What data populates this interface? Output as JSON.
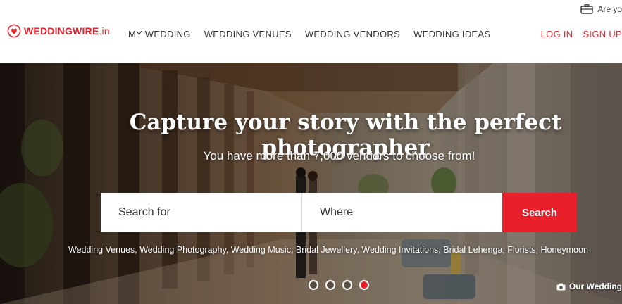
{
  "header": {
    "topbar_text": "Are yo",
    "logo": {
      "name": "WEDDINGWIRE",
      "domain": ".in",
      "color": "#e0242e"
    },
    "nav": [
      "MY WEDDING",
      "WEDDING VENUES",
      "WEDDING VENDORS",
      "WEDDING IDEAS"
    ],
    "login": "LOG IN",
    "signup": "SIGN UP"
  },
  "hero": {
    "headline": "Capture your story with the perfect photographer",
    "subline": "You have more than 7,000 vendors to choose from!",
    "search": {
      "search_placeholder": "Search for",
      "where_placeholder": "Where",
      "button": "Search"
    },
    "quicklinks": "Wedding Venues, Wedding Photography, Wedding Music, Bridal Jewellery, Wedding Invitations, Bridal Lehenga, Florists, Honeymoon",
    "carousel": {
      "count": 4,
      "active_index": 3
    },
    "credit": "Our Wedding"
  },
  "colors": {
    "accent": "#e8202b",
    "brand": "#e0242e"
  },
  "icons": [
    "briefcase-icon",
    "logo-mark-icon",
    "camera-icon"
  ]
}
